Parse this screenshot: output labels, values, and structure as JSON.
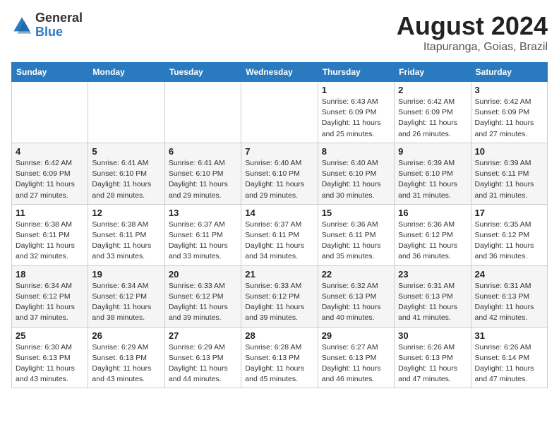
{
  "logo": {
    "general": "General",
    "blue": "Blue"
  },
  "title": {
    "month": "August 2024",
    "location": "Itapuranga, Goias, Brazil"
  },
  "weekdays": [
    "Sunday",
    "Monday",
    "Tuesday",
    "Wednesday",
    "Thursday",
    "Friday",
    "Saturday"
  ],
  "weeks": [
    [
      {
        "day": "",
        "info": ""
      },
      {
        "day": "",
        "info": ""
      },
      {
        "day": "",
        "info": ""
      },
      {
        "day": "",
        "info": ""
      },
      {
        "day": "1",
        "info": "Sunrise: 6:43 AM\nSunset: 6:09 PM\nDaylight: 11 hours\nand 25 minutes."
      },
      {
        "day": "2",
        "info": "Sunrise: 6:42 AM\nSunset: 6:09 PM\nDaylight: 11 hours\nand 26 minutes."
      },
      {
        "day": "3",
        "info": "Sunrise: 6:42 AM\nSunset: 6:09 PM\nDaylight: 11 hours\nand 27 minutes."
      }
    ],
    [
      {
        "day": "4",
        "info": "Sunrise: 6:42 AM\nSunset: 6:09 PM\nDaylight: 11 hours\nand 27 minutes."
      },
      {
        "day": "5",
        "info": "Sunrise: 6:41 AM\nSunset: 6:10 PM\nDaylight: 11 hours\nand 28 minutes."
      },
      {
        "day": "6",
        "info": "Sunrise: 6:41 AM\nSunset: 6:10 PM\nDaylight: 11 hours\nand 29 minutes."
      },
      {
        "day": "7",
        "info": "Sunrise: 6:40 AM\nSunset: 6:10 PM\nDaylight: 11 hours\nand 29 minutes."
      },
      {
        "day": "8",
        "info": "Sunrise: 6:40 AM\nSunset: 6:10 PM\nDaylight: 11 hours\nand 30 minutes."
      },
      {
        "day": "9",
        "info": "Sunrise: 6:39 AM\nSunset: 6:10 PM\nDaylight: 11 hours\nand 31 minutes."
      },
      {
        "day": "10",
        "info": "Sunrise: 6:39 AM\nSunset: 6:11 PM\nDaylight: 11 hours\nand 31 minutes."
      }
    ],
    [
      {
        "day": "11",
        "info": "Sunrise: 6:38 AM\nSunset: 6:11 PM\nDaylight: 11 hours\nand 32 minutes."
      },
      {
        "day": "12",
        "info": "Sunrise: 6:38 AM\nSunset: 6:11 PM\nDaylight: 11 hours\nand 33 minutes."
      },
      {
        "day": "13",
        "info": "Sunrise: 6:37 AM\nSunset: 6:11 PM\nDaylight: 11 hours\nand 33 minutes."
      },
      {
        "day": "14",
        "info": "Sunrise: 6:37 AM\nSunset: 6:11 PM\nDaylight: 11 hours\nand 34 minutes."
      },
      {
        "day": "15",
        "info": "Sunrise: 6:36 AM\nSunset: 6:11 PM\nDaylight: 11 hours\nand 35 minutes."
      },
      {
        "day": "16",
        "info": "Sunrise: 6:36 AM\nSunset: 6:12 PM\nDaylight: 11 hours\nand 36 minutes."
      },
      {
        "day": "17",
        "info": "Sunrise: 6:35 AM\nSunset: 6:12 PM\nDaylight: 11 hours\nand 36 minutes."
      }
    ],
    [
      {
        "day": "18",
        "info": "Sunrise: 6:34 AM\nSunset: 6:12 PM\nDaylight: 11 hours\nand 37 minutes."
      },
      {
        "day": "19",
        "info": "Sunrise: 6:34 AM\nSunset: 6:12 PM\nDaylight: 11 hours\nand 38 minutes."
      },
      {
        "day": "20",
        "info": "Sunrise: 6:33 AM\nSunset: 6:12 PM\nDaylight: 11 hours\nand 39 minutes."
      },
      {
        "day": "21",
        "info": "Sunrise: 6:33 AM\nSunset: 6:12 PM\nDaylight: 11 hours\nand 39 minutes."
      },
      {
        "day": "22",
        "info": "Sunrise: 6:32 AM\nSunset: 6:13 PM\nDaylight: 11 hours\nand 40 minutes."
      },
      {
        "day": "23",
        "info": "Sunrise: 6:31 AM\nSunset: 6:13 PM\nDaylight: 11 hours\nand 41 minutes."
      },
      {
        "day": "24",
        "info": "Sunrise: 6:31 AM\nSunset: 6:13 PM\nDaylight: 11 hours\nand 42 minutes."
      }
    ],
    [
      {
        "day": "25",
        "info": "Sunrise: 6:30 AM\nSunset: 6:13 PM\nDaylight: 11 hours\nand 43 minutes."
      },
      {
        "day": "26",
        "info": "Sunrise: 6:29 AM\nSunset: 6:13 PM\nDaylight: 11 hours\nand 43 minutes."
      },
      {
        "day": "27",
        "info": "Sunrise: 6:29 AM\nSunset: 6:13 PM\nDaylight: 11 hours\nand 44 minutes."
      },
      {
        "day": "28",
        "info": "Sunrise: 6:28 AM\nSunset: 6:13 PM\nDaylight: 11 hours\nand 45 minutes."
      },
      {
        "day": "29",
        "info": "Sunrise: 6:27 AM\nSunset: 6:13 PM\nDaylight: 11 hours\nand 46 minutes."
      },
      {
        "day": "30",
        "info": "Sunrise: 6:26 AM\nSunset: 6:13 PM\nDaylight: 11 hours\nand 47 minutes."
      },
      {
        "day": "31",
        "info": "Sunrise: 6:26 AM\nSunset: 6:14 PM\nDaylight: 11 hours\nand 47 minutes."
      }
    ]
  ]
}
